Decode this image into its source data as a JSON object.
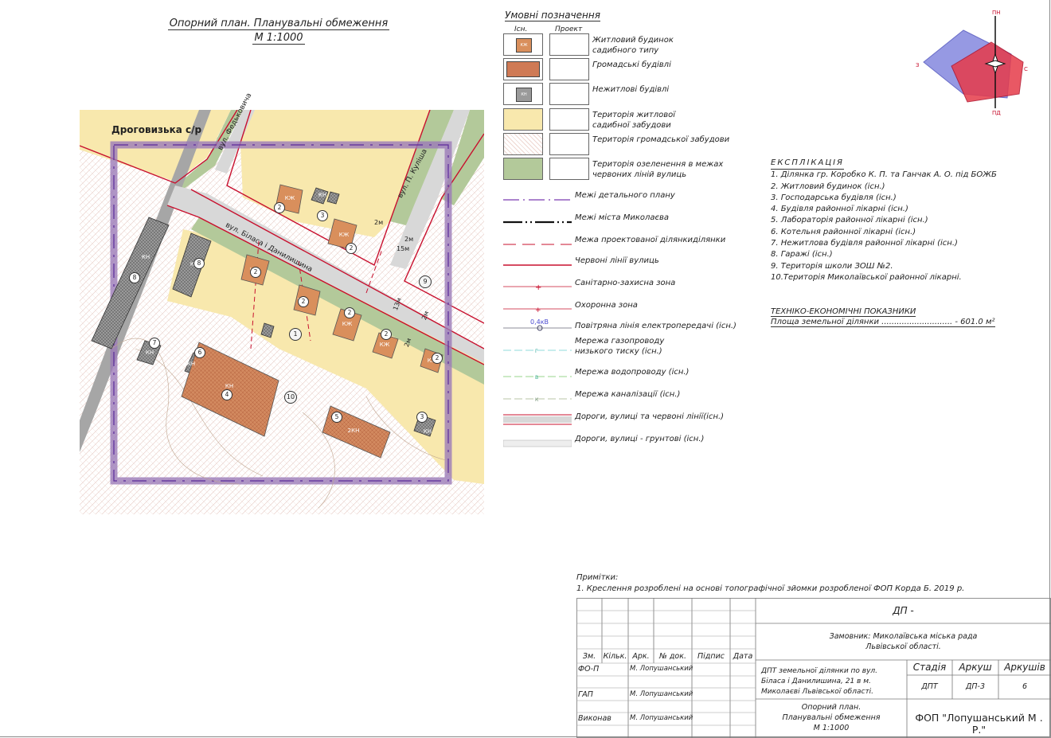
{
  "title": {
    "line1": "Опорний план. Планувальні обмеження",
    "line2": "М 1:1000"
  },
  "map": {
    "labels": {
      "settlement": "Дроговизька с/р",
      "street_fedkovych": "вул. Федьковича",
      "street_bilas": "вул. Біласа і Данилишина",
      "street_kulish": "вул. П. Куліша",
      "dim_2m_a": "2м",
      "dim_2m_b": "2м",
      "dim_15m": "15м",
      "dim_13m": "13м",
      "dim_2m_c": "2м",
      "dim_2m_d": "2м"
    },
    "buildings": [
      {
        "code": "КЖ",
        "num": "2"
      },
      {
        "code": "КН",
        "num": "3"
      },
      {
        "code": "КЖ",
        "num": "2"
      },
      {
        "code": "КЖ",
        "num": "2"
      },
      {
        "code": "КЖ",
        "num": "2"
      },
      {
        "code": "КЖ",
        "num": "2"
      },
      {
        "code": "КЖ",
        "num": "2"
      },
      {
        "code": "КЖ",
        "num": "2"
      },
      {
        "code": "КН",
        "num": "8"
      },
      {
        "code": "КН",
        "num": "8"
      },
      {
        "code": "КН",
        "num": "7"
      },
      {
        "code": "КН",
        "num": "6"
      },
      {
        "code": "КН",
        "num": "4"
      },
      {
        "code": "2КН",
        "num": "5"
      },
      {
        "code": "КН",
        "num": "3"
      }
    ],
    "plot_nums": {
      "p1": "1",
      "p9": "9",
      "p10": "10"
    }
  },
  "compass": {
    "n": "ПН",
    "s": "ПД",
    "w": "З",
    "e": "С"
  },
  "legend": {
    "title": "Умовні позначення",
    "col_existing": "Існ.",
    "col_project": "Проект",
    "items": [
      "Житловий будинок\nсадибного типу",
      "Громадські будівлі",
      "Нежитлові будівлі",
      "Територія житлової\nсадибної забудови",
      "Територія громадської забудови",
      "Територія озеленення в межах\nчервоних ліній вулиць",
      "Межі детального плану",
      "Межі міста Миколаєва",
      "Межа проектованої ділянкиділянки",
      "Червоні лінії вулиць",
      "Санітарно-захисна зона",
      "Охоронна зона",
      "Повітряна лінія електропередачі (існ.)",
      "Мережа газопроводу\nнизького тиску (існ.)",
      "Мережа водопроводу (існ.)",
      "Мережа каналізації (існ.)",
      "Дороги, вулиці та червоні лінії(існ.)",
      "Дороги, вулиці - грунтові (існ.)"
    ],
    "icon_kzh": "КЖ",
    "icon_kn": "КН",
    "power_label": "0,4кВ",
    "gas_mark": "Г",
    "water_mark": "В",
    "sewer_mark": "К"
  },
  "explication": {
    "title": "ЕКСПЛІКАЦІЯ",
    "items": [
      "1.  Ділянка гр. Коробко К. П. та Ганчак А. О. під БОЖБ",
      "2. Житловий будинок (існ.)",
      "3. Господарська будівля (існ.)",
      "4. Будівля районної лікарні (існ.)",
      "5. Лабораторія районної лікарні (існ.)",
      "6. Котельня районної лікарні (існ.)",
      "7. Нежитлова будівля районної лікарні (існ.)",
      "8. Гаражі (існ.)",
      "9. Територія школи ЗОШ №2.",
      "10.Територія Миколаївської районної лікарні."
    ]
  },
  "tep": {
    "title": "ТЕХНІКО-ЕКОНОМІЧНІ ПОКАЗНИКИ",
    "row": "Площа земельної ділянки ............................ - 601.0  м²"
  },
  "notes": {
    "title": "Примітки:",
    "line1": "1. Креслення розроблені на основі  топографічної зйомки розробленої ФОП Корда Б. 2019 р."
  },
  "stamp": {
    "code": "ДП -",
    "customer": "Замовник: Миколаївська міська рада\nЛьвівської області.",
    "headers": [
      "Зм.",
      "Кільк.",
      "Арк.",
      "№ док.",
      "Підпис",
      "Дата"
    ],
    "role1": "ФО-П",
    "name1": "М. Лопушанський",
    "role2": "ГАП",
    "name2": "М. Лопушанський",
    "role3": "Виконав",
    "name3": "М. Лопушанський",
    "project": "ДПТ земельної ділянки по вул.\nБіласа і Данилишина, 21 в м.\nМиколаєві Львівської області.",
    "stage_h": "Стадія",
    "sheet_h": "Аркуш",
    "sheets_h": "Аркушів",
    "stage": "ДПТ",
    "sheet": "ДП-3",
    "sheets": "6",
    "drawing": "Опорний план.\nПланувальні обмеження\nМ 1:1000",
    "firm": "ФОП \"Лопушанський М . Р.\""
  },
  "colors": {
    "residential": "#d98f5c",
    "public": "#cf7a55",
    "yellow": "#f8e8ad",
    "green": "#b3c99a",
    "purple": "#9b7bb8",
    "red": "#c8102e"
  }
}
